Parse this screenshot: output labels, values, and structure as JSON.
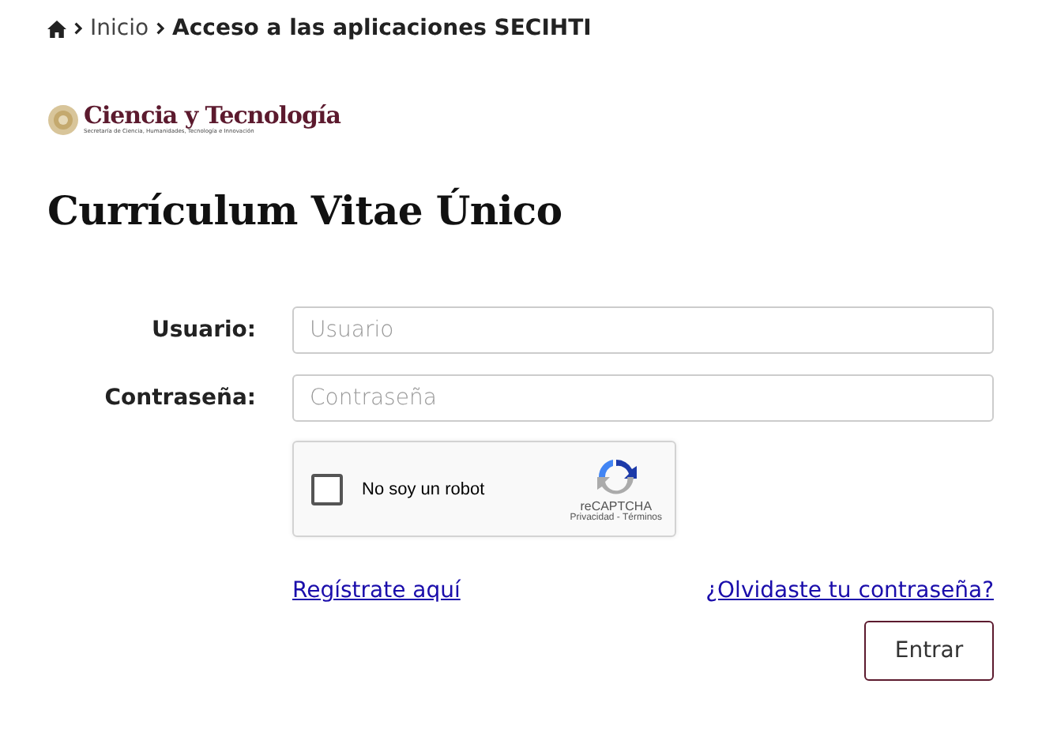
{
  "breadcrumb": [
    {
      "label": "Inicio",
      "current": false
    },
    {
      "label": "Acceso a las aplicaciones SECIHTI",
      "current": true
    }
  ],
  "logo": {
    "title": "Ciencia y Tecnología",
    "subtitle": "Secretaría de Ciencia, Humanidades, Tecnología e Innovación"
  },
  "heading": "Currículum Vitae Único",
  "fields": [
    {
      "label": "Usuario:",
      "placeholder": "Usuario"
    },
    {
      "label": "Contraseña:",
      "placeholder": "Contraseña"
    }
  ],
  "captcha": {
    "label": "No soy un robot",
    "checked": false,
    "brand": "reCAPTCHA",
    "terms": "Privacidad - Términos"
  },
  "links": [
    "Regístrate aquí",
    "¿Olvidaste tu contraseña?"
  ],
  "submit": "Entrar"
}
